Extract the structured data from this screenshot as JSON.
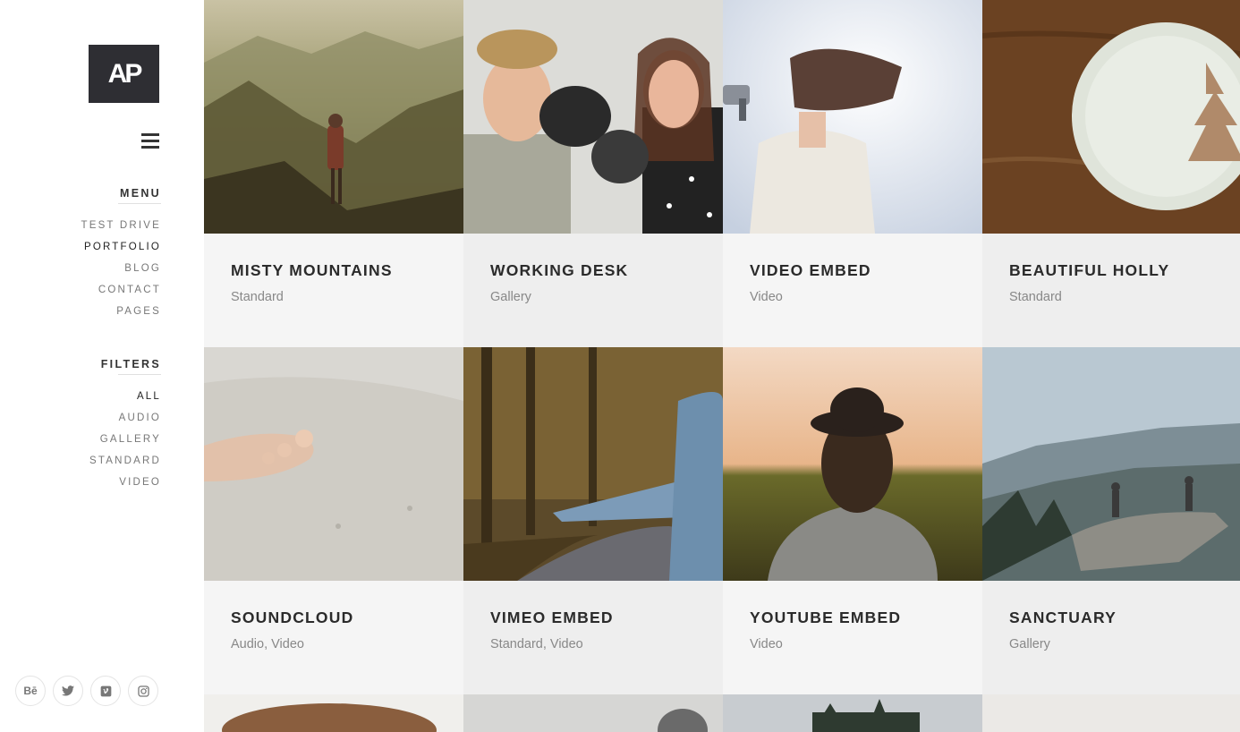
{
  "brand": {
    "logo_text": "AP"
  },
  "menu": {
    "title": "MENU",
    "items": [
      {
        "label": "TEST DRIVE",
        "active": false
      },
      {
        "label": "PORTFOLIO",
        "active": true
      },
      {
        "label": "BLOG",
        "active": false
      },
      {
        "label": "CONTACT",
        "active": false
      },
      {
        "label": "PAGES",
        "active": false
      }
    ]
  },
  "filters": {
    "title": "FILTERS",
    "items": [
      {
        "label": "ALL",
        "active": true
      },
      {
        "label": "AUDIO",
        "active": false
      },
      {
        "label": "GALLERY",
        "active": false
      },
      {
        "label": "STANDARD",
        "active": false
      },
      {
        "label": "VIDEO",
        "active": false
      }
    ]
  },
  "socials": [
    {
      "icon": "behance-icon",
      "glyph": "Bē"
    },
    {
      "icon": "twitter-icon",
      "glyph": "🐦"
    },
    {
      "icon": "vimeo-icon",
      "glyph": "v"
    },
    {
      "icon": "instagram-icon",
      "glyph": "◘"
    }
  ],
  "portfolio": [
    {
      "title": "MISTY MOUNTAINS",
      "categories": "Standard"
    },
    {
      "title": "WORKING DESK",
      "categories": "Gallery"
    },
    {
      "title": "VIDEO EMBED",
      "categories": "Video"
    },
    {
      "title": "BEAUTIFUL HOLLY",
      "categories": "Standard"
    },
    {
      "title": "SOUNDCLOUD",
      "categories": "Audio, Video"
    },
    {
      "title": "VIMEO EMBED",
      "categories": "Standard, Video"
    },
    {
      "title": "YOUTUBE EMBED",
      "categories": "Video"
    },
    {
      "title": "SANCTUARY",
      "categories": "Gallery"
    }
  ]
}
